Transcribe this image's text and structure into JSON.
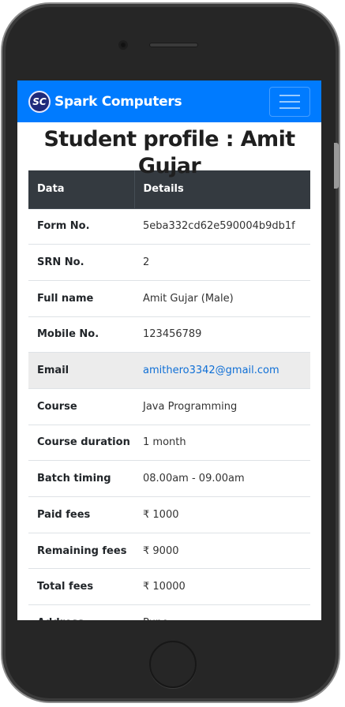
{
  "navbar": {
    "logo_text": "SC",
    "brand": "Spark Computers"
  },
  "title": "Student profile : Amit Gujar",
  "table": {
    "headers": [
      "Data",
      "Details"
    ],
    "rows": [
      {
        "label": "Form No.",
        "value": "5eba332cd62e590004b9db1f"
      },
      {
        "label": "SRN No.",
        "value": "2"
      },
      {
        "label": "Full name",
        "value": "Amit Gujar (Male)"
      },
      {
        "label": "Mobile No.",
        "value": "123456789"
      },
      {
        "label": "Email",
        "value": "amithero3342@gmail.com"
      },
      {
        "label": "Course",
        "value": "Java Programming"
      },
      {
        "label": "Course duration",
        "value": "1 month"
      },
      {
        "label": "Batch timing",
        "value": "08.00am - 09.00am"
      },
      {
        "label": "Paid fees",
        "value": "₹ 1000"
      },
      {
        "label": "Remaining fees",
        "value": "₹ 9000"
      },
      {
        "label": "Total fees",
        "value": "₹ 10000"
      },
      {
        "label": "Address",
        "value": "Pune"
      }
    ]
  },
  "colors": {
    "navbar": "#007bff",
    "table_header": "#343a40",
    "link": "#0f6fd6"
  }
}
